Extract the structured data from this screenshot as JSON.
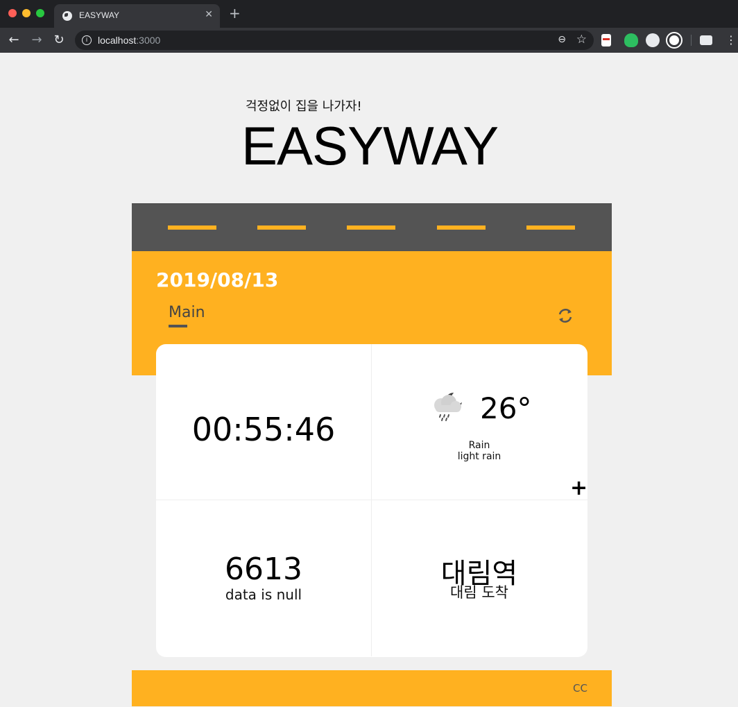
{
  "browser": {
    "tab_title": "EASYWAY",
    "tab_close": "✕",
    "new_tab": "+",
    "url_host": "localhost",
    "url_port": ":3000"
  },
  "page": {
    "subtitle": "걱정없이 집을 나가자!",
    "brand": "EASYWAY",
    "date": "2019/08/13",
    "tab_label": "Main",
    "colors": {
      "accent": "#ffb120",
      "road": "#545454",
      "background": "#f0f0f0"
    }
  },
  "widgets": {
    "clock": {
      "time": "00:55:46"
    },
    "weather": {
      "icon": "cloud-rain-moon-icon",
      "temperature": "26°",
      "main": "Rain",
      "description": "light rain",
      "add_label": "+"
    },
    "bus": {
      "number": "6613",
      "status": "data is null"
    },
    "station": {
      "name": "대림역",
      "arrival": "대림 도착"
    }
  },
  "footer": {
    "text": "CC"
  }
}
